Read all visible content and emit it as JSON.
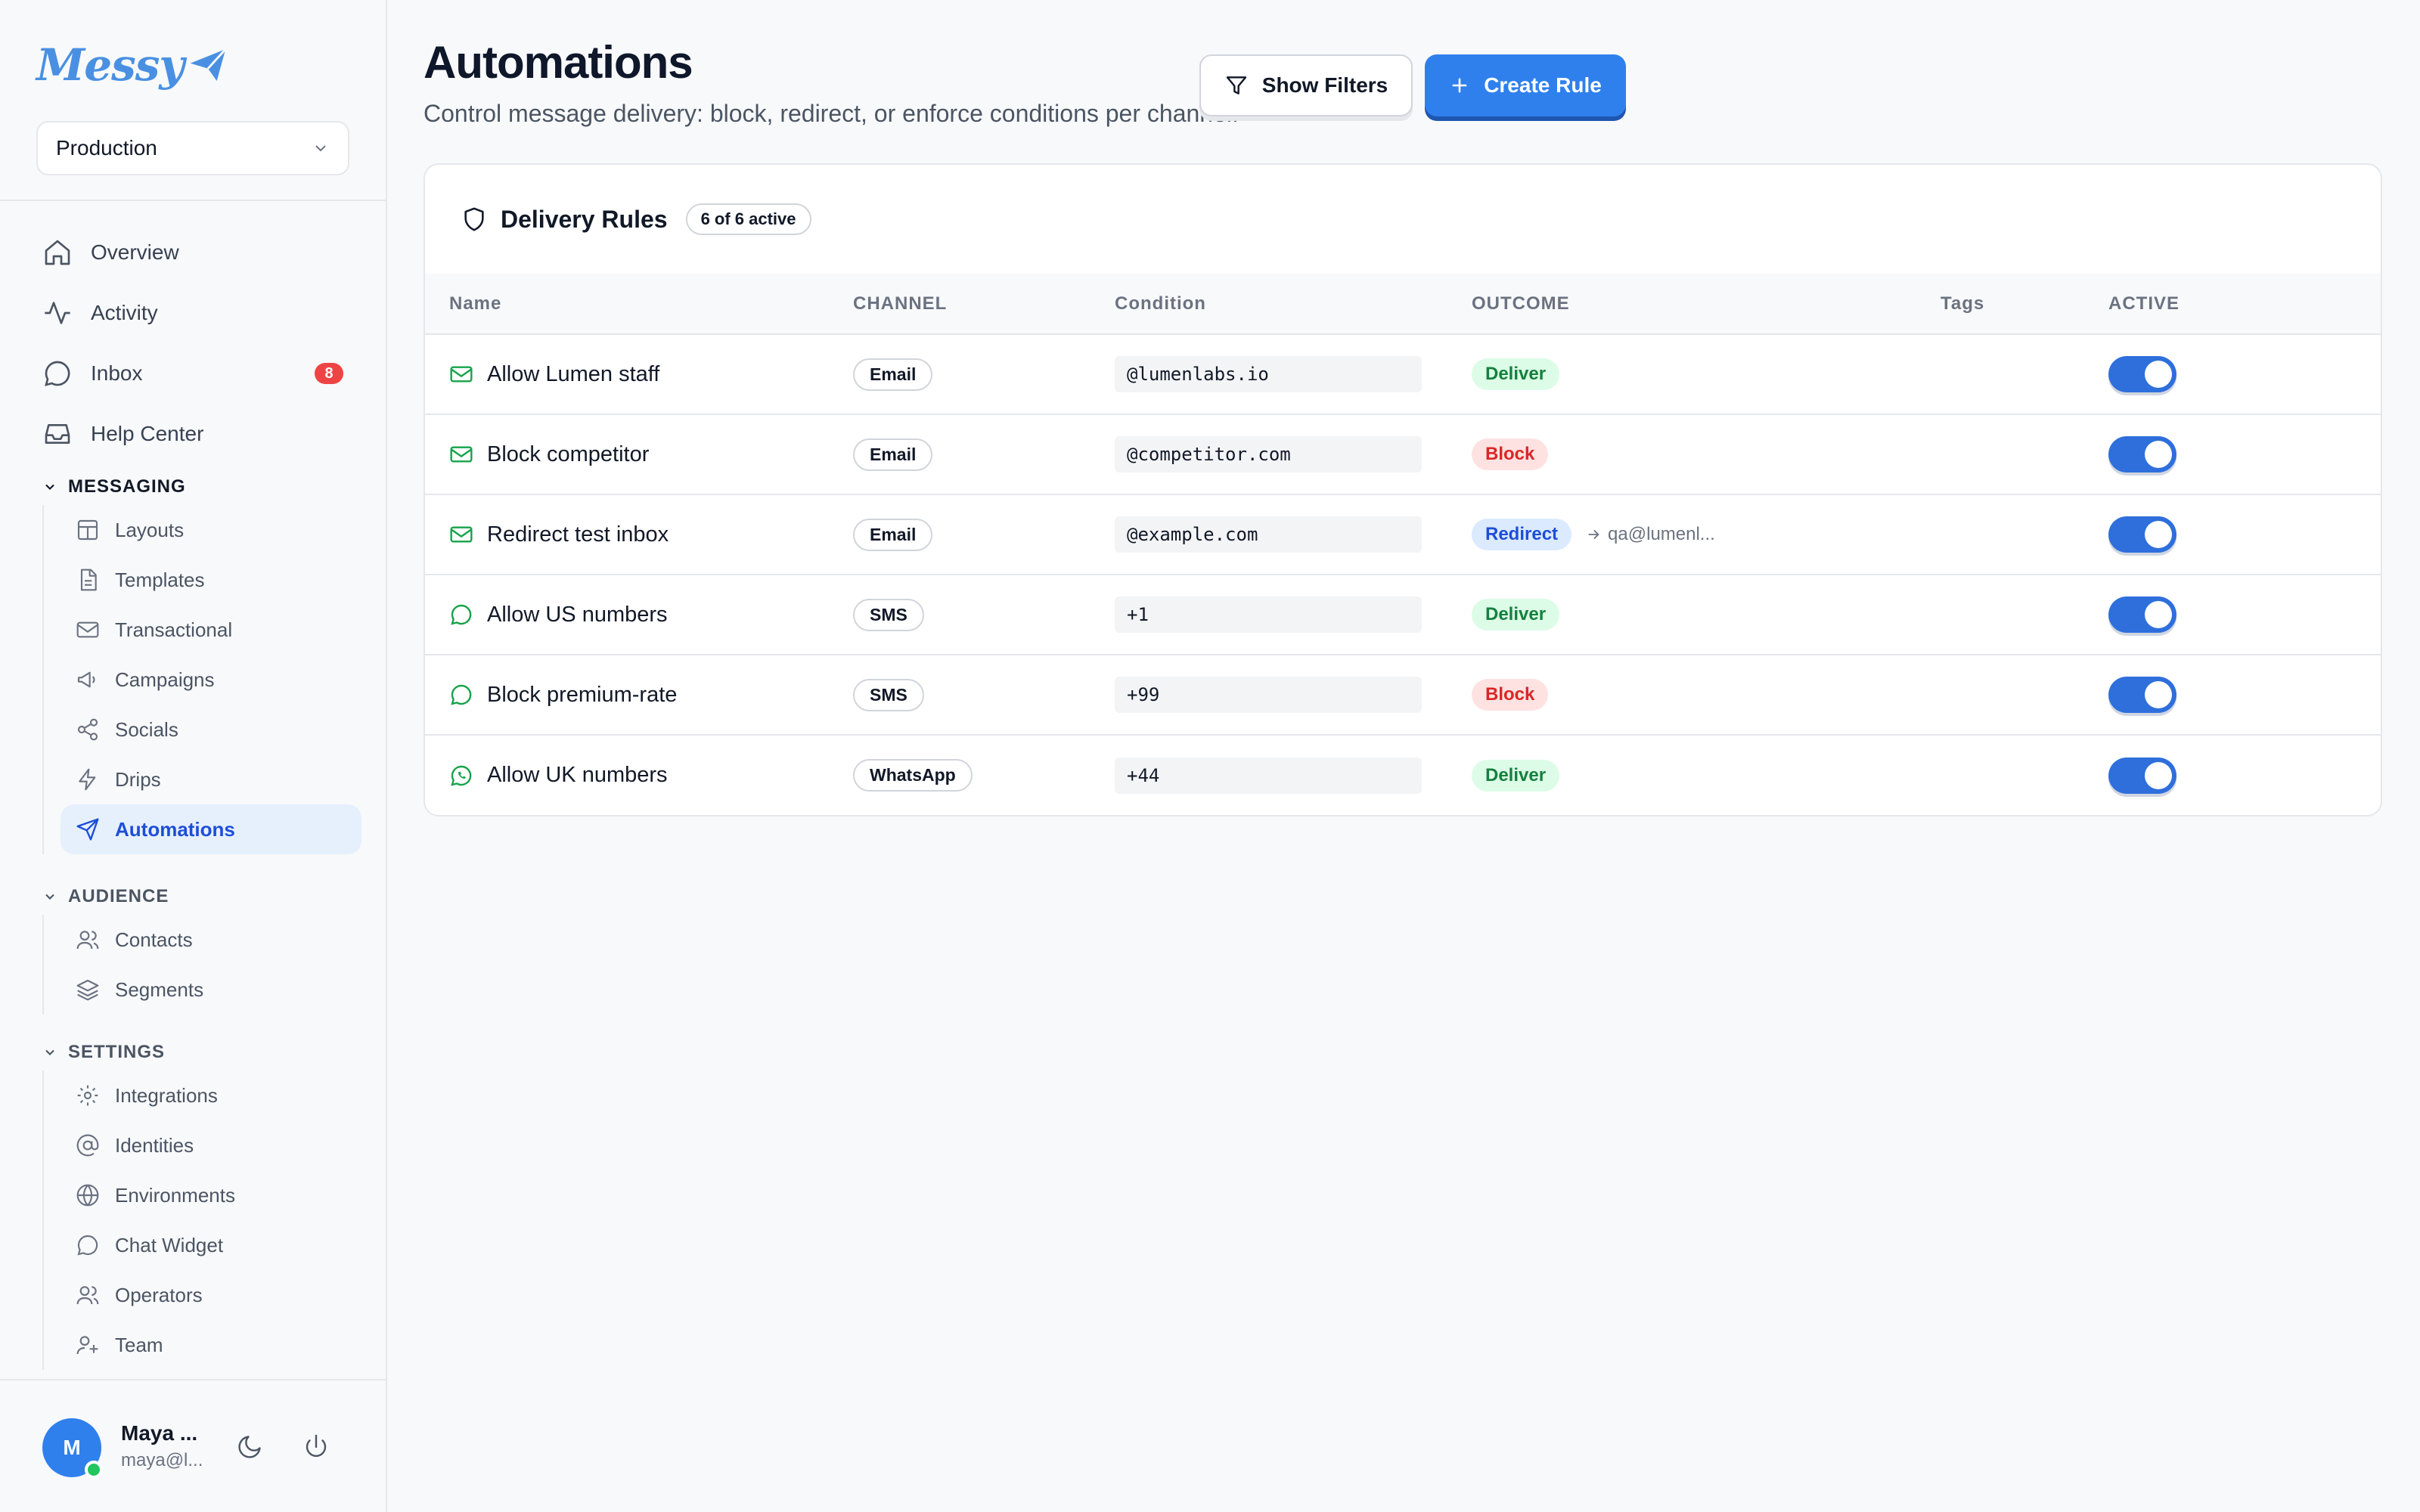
{
  "app": {
    "logo_text": "Messy",
    "environment": "Production"
  },
  "sidebar": {
    "nav": [
      {
        "label": "Overview",
        "icon": "home-icon"
      },
      {
        "label": "Activity",
        "icon": "activity-icon"
      },
      {
        "label": "Inbox",
        "icon": "message-icon",
        "badge": "8"
      },
      {
        "label": "Help Center",
        "icon": "inbox-tray-icon"
      }
    ],
    "sections": [
      {
        "title": "MESSAGING",
        "items": [
          {
            "label": "Layouts",
            "icon": "layout-icon"
          },
          {
            "label": "Templates",
            "icon": "file-icon"
          },
          {
            "label": "Transactional",
            "icon": "mail-icon"
          },
          {
            "label": "Campaigns",
            "icon": "megaphone-icon"
          },
          {
            "label": "Socials",
            "icon": "share-icon"
          },
          {
            "label": "Drips",
            "icon": "lightning-icon"
          },
          {
            "label": "Automations",
            "icon": "send-icon",
            "active": true
          }
        ]
      },
      {
        "title": "AUDIENCE",
        "items": [
          {
            "label": "Contacts",
            "icon": "users-icon"
          },
          {
            "label": "Segments",
            "icon": "layers-icon"
          }
        ]
      },
      {
        "title": "SETTINGS",
        "items": [
          {
            "label": "Integrations",
            "icon": "gear-icon"
          },
          {
            "label": "Identities",
            "icon": "at-icon"
          },
          {
            "label": "Environments",
            "icon": "globe-icon"
          },
          {
            "label": "Chat Widget",
            "icon": "chat-icon"
          },
          {
            "label": "Operators",
            "icon": "users-icon"
          },
          {
            "label": "Team",
            "icon": "team-icon"
          }
        ]
      }
    ],
    "user": {
      "initial": "M",
      "name": "Maya ...",
      "email": "maya@l..."
    }
  },
  "header": {
    "title": "Automations",
    "subtitle": "Control message delivery: block, redirect, or enforce conditions per channel.",
    "filters_label": "Show Filters",
    "create_label": "Create Rule"
  },
  "rules_card": {
    "title": "Delivery Rules",
    "count": "6 of 6 active",
    "columns": [
      "Name",
      "CHANNEL",
      "Condition",
      "OUTCOME",
      "Tags",
      "ACTIVE"
    ],
    "rows": [
      {
        "icon": "mail-icon",
        "name": "Allow Lumen staff",
        "channel": "Email",
        "condition": "@lumenlabs.io",
        "outcome": "Deliver",
        "outcome_type": "deliver",
        "target": "",
        "active": true
      },
      {
        "icon": "mail-icon",
        "name": "Block competitor",
        "channel": "Email",
        "condition": "@competitor.com",
        "outcome": "Block",
        "outcome_type": "block",
        "target": "",
        "active": true
      },
      {
        "icon": "mail-icon",
        "name": "Redirect test inbox",
        "channel": "Email",
        "condition": "@example.com",
        "outcome": "Redirect",
        "outcome_type": "redirect",
        "target": "qa@lumenl...",
        "active": true
      },
      {
        "icon": "chat-icon",
        "name": "Allow US numbers",
        "channel": "SMS",
        "condition": "+1",
        "outcome": "Deliver",
        "outcome_type": "deliver",
        "target": "",
        "active": true
      },
      {
        "icon": "chat-icon",
        "name": "Block premium-rate",
        "channel": "SMS",
        "condition": "+99",
        "outcome": "Block",
        "outcome_type": "block",
        "target": "",
        "active": true
      },
      {
        "icon": "whatsapp-icon",
        "name": "Allow UK numbers",
        "channel": "WhatsApp",
        "condition": "+44",
        "outcome": "Deliver",
        "outcome_type": "deliver",
        "target": "",
        "active": true
      }
    ]
  },
  "colors": {
    "accent": "#2f80ed",
    "deliver": "#15803d",
    "block": "#dc2626",
    "redirect": "#1d4ed8",
    "channel_icon": "#16a34a"
  }
}
